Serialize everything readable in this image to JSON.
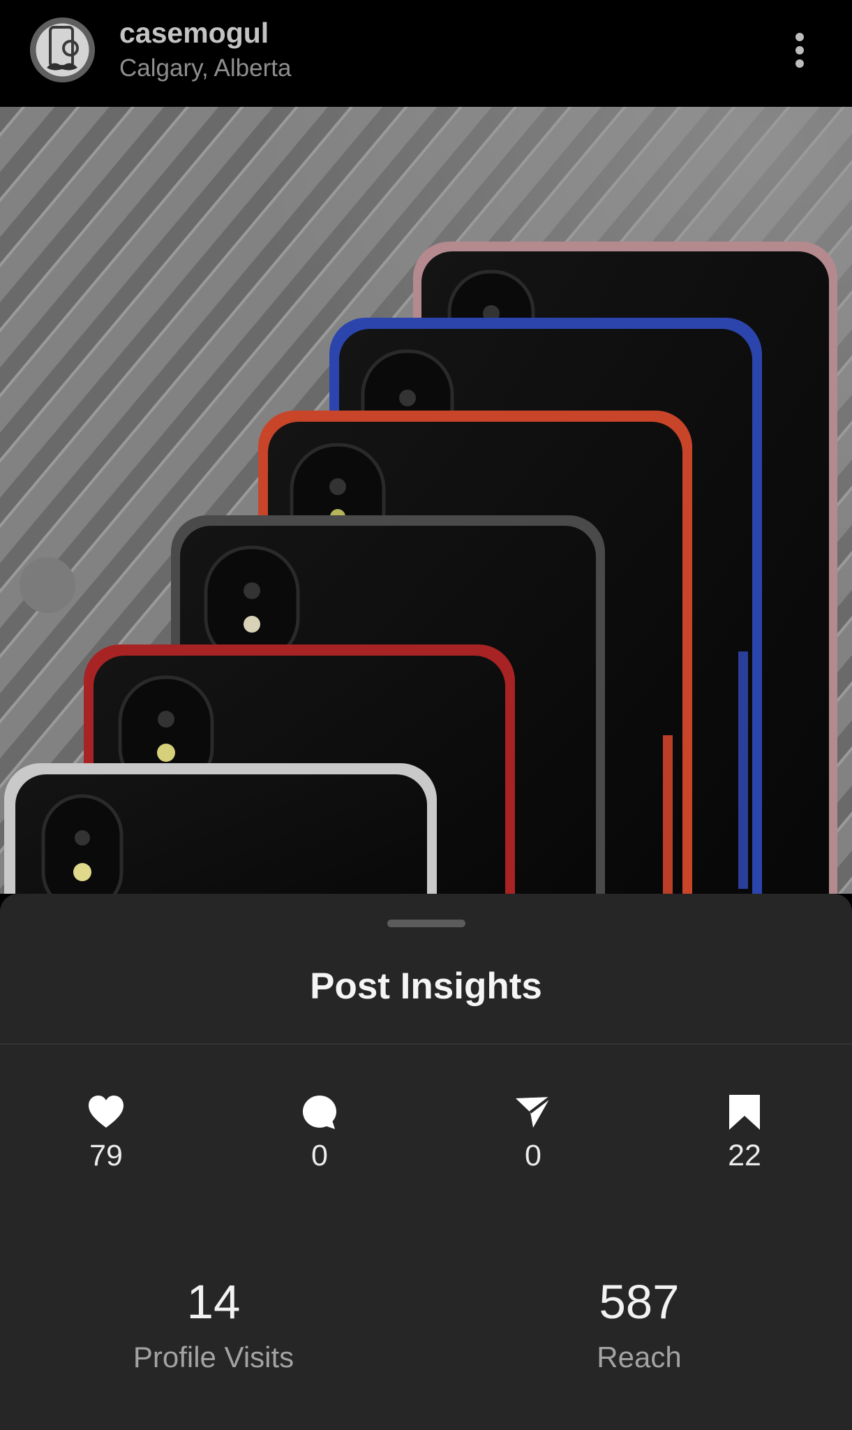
{
  "header": {
    "username": "casemogul",
    "location": "Calgary, Alberta",
    "avatar_icon": "phone-monogram-logo",
    "more_icon": "more-vertical-icon"
  },
  "post": {
    "image_subject": "phone cases",
    "carousel_indicator": "carousel-dot"
  },
  "insights": {
    "title": "Post Insights",
    "metrics": [
      {
        "icon": "heart-icon",
        "value": "79"
      },
      {
        "icon": "comment-icon",
        "value": "0"
      },
      {
        "icon": "share-icon",
        "value": "0"
      },
      {
        "icon": "bookmark-icon",
        "value": "22"
      }
    ],
    "stats": [
      {
        "value": "14",
        "label": "Profile Visits"
      },
      {
        "value": "587",
        "label": "Reach"
      }
    ]
  },
  "colors": {
    "sheet_background": "#262626",
    "header_background": "#000000",
    "accent_pink": "#c98b93",
    "accent_blue": "#2f4fc4",
    "accent_orange": "#d9462a",
    "accent_red": "#c12a2a"
  }
}
